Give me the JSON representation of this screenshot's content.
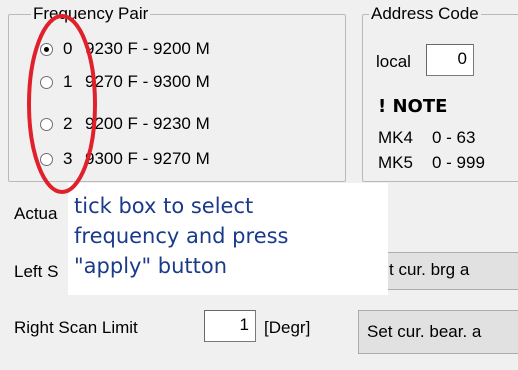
{
  "frequency_pair": {
    "legend": "Frequency Pair",
    "options": [
      {
        "index": "0",
        "label": "9230 F - 9200 M",
        "checked": true
      },
      {
        "index": "1",
        "label": "9270 F - 9300 M",
        "checked": false
      },
      {
        "index": "2",
        "label": "9200 F - 9230 M",
        "checked": false
      },
      {
        "index": "3",
        "label": "9300 F - 9270 M",
        "checked": false
      }
    ]
  },
  "address_code": {
    "legend": "Address Code",
    "local_label": "local",
    "local_value": "0",
    "note_title": "! NOTE",
    "note_rows": [
      {
        "model": "MK4",
        "range": "0 - 63"
      },
      {
        "model": "MK5",
        "range": "0 - 999"
      }
    ]
  },
  "actual_label": "Actua",
  "left_scan_label": "Left S",
  "left_button_label": "t cur. brg a",
  "right_scan": {
    "label": "Right Scan Limit",
    "value": "1",
    "unit": "[Degr]",
    "button_label": "Set cur. bear. a"
  },
  "annotation": {
    "text_lines": [
      "tick box to select",
      "frequency and press",
      "\"apply\" button"
    ],
    "ellipse_color": "#e0202a",
    "text_color": "#1a3a8a"
  }
}
